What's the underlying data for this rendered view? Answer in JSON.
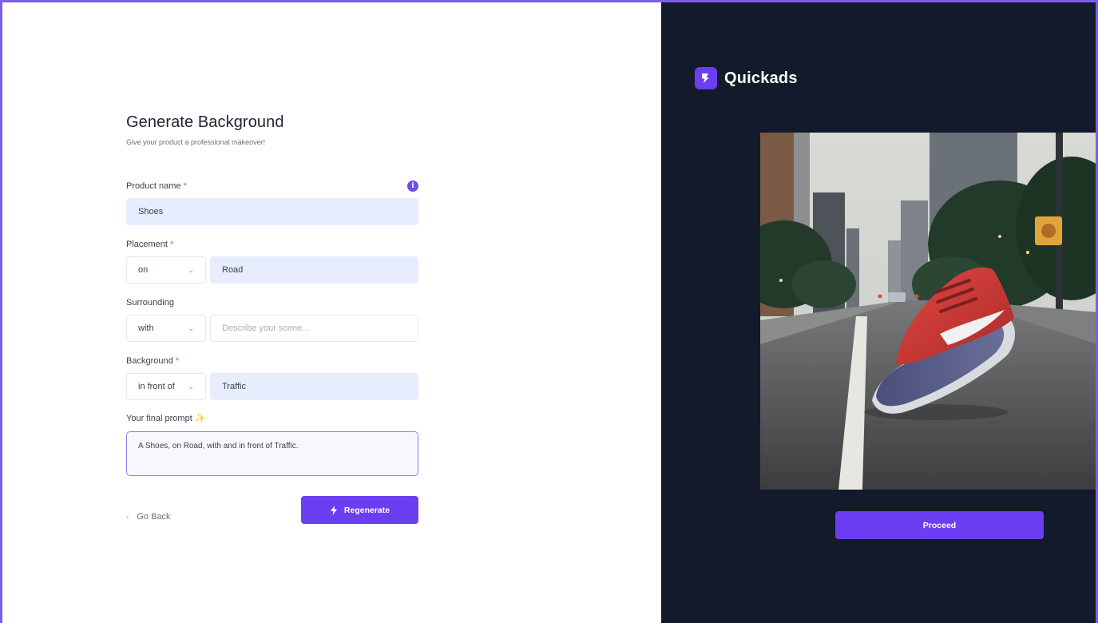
{
  "form": {
    "title": "Generate Background",
    "subtitle": "Give your product a professional makeover!",
    "product_name": {
      "label": "Product name",
      "required_mark": "*",
      "value": "Shoes"
    },
    "placement": {
      "label": "Placement",
      "required_mark": "*",
      "preposition": "on",
      "value": "Road"
    },
    "surrounding": {
      "label": "Surrounding",
      "preposition": "with",
      "placeholder": "Describe your scene..."
    },
    "background": {
      "label": "Background",
      "required_mark": "*",
      "preposition": "in front of",
      "value": "Traffic"
    },
    "final_prompt": {
      "label": "Your final prompt",
      "sparkle": "✨",
      "value": "A Shoes, on Road, with  and in front of Traffic."
    },
    "back_label": "Go Back",
    "regenerate_label": "Regenerate"
  },
  "brand": {
    "name": "Quickads",
    "accent": "#6c3ef2"
  },
  "preview": {
    "proceed_label": "Proceed"
  },
  "icons": {
    "info": "info-icon",
    "chevron": "chevron-down-icon",
    "back": "chevron-left-icon",
    "bolt": "bolt-icon"
  },
  "colors": {
    "panel_dark": "#121a2b",
    "field_fill": "#e8edfd",
    "frame": "#7c5cf0"
  }
}
